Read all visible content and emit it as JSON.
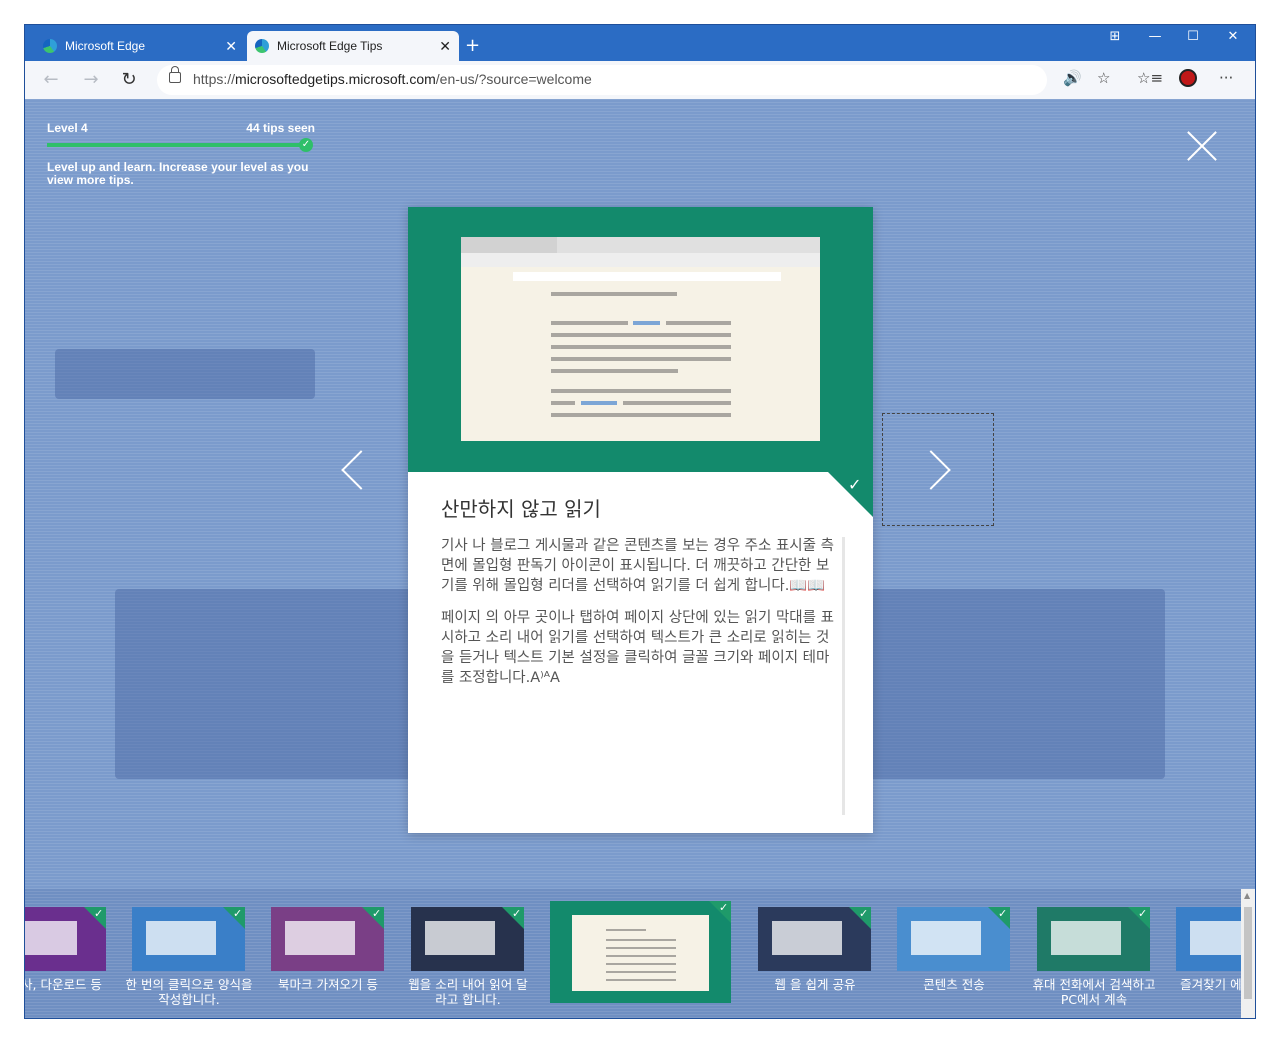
{
  "tabs": [
    {
      "label": "Microsoft Edge",
      "close": "✕"
    },
    {
      "label": "Microsoft Edge Tips",
      "close": "✕"
    }
  ],
  "new_tab": "+",
  "window_controls": {
    "minimize": "—",
    "maximize": "☐",
    "close": "✕",
    "extra": "⊞"
  },
  "nav": {
    "back": "←",
    "forward": "→",
    "refresh": "↻"
  },
  "address": {
    "scheme": "https://",
    "host": "microsoftedgetips.microsoft.com",
    "path": "/en-us/?source=welcome"
  },
  "toolbar_icons": {
    "read_aloud": "🔊",
    "favorite": "☆",
    "collections": "☆≡",
    "more": "···"
  },
  "level": {
    "label": "Level 4",
    "tips_seen": "44 tips seen",
    "progress": 1.0,
    "description": "Level up and learn. Increase your level as you view more tips."
  },
  "card": {
    "title": "산만하지 않고 읽기",
    "paragraphs": [
      "기사 나 블로그 게시물과 같은 콘텐츠를 보는 경우 주소 표시줄 측면에 몰입형 판독기 아이콘이 표시됩니다. 더 깨끗하고 간단한 보기를 위해 몰입형 리더를 선택하여 읽기를 더 쉽게 합니다.📖📖",
      "페이지 의 아무 곳이나 탭하여 페이지 상단에 있는 읽기 막대를 표시하고 소리 내어 읽기를 선택하여 텍스트가 큰 소리로 읽히는 것을 듣거나 텍스트 기본 설정을 클릭하여 글꼴 크기와 페이지 테마를 조정합니다.A⁾ᴬA"
    ]
  },
  "carousel": [
    {
      "label": "l, 역사, 다운로드 등",
      "color": "#6a2f8e",
      "seen": true
    },
    {
      "label": "한 번의 클릭으로 양식을 작성합니다.",
      "color": "#3a7fc8",
      "seen": true
    },
    {
      "label": "북마크 가져오기 등",
      "color": "#7a3f86",
      "seen": true
    },
    {
      "label": "웹을 소리 내어 읽어 달라고 합니다.",
      "color": "#27324d",
      "seen": true
    },
    {
      "label": "",
      "color": "#138a6c",
      "seen": true,
      "active": true
    },
    {
      "label": "웹 을 쉽게 공유",
      "color": "#2b3a5c",
      "seen": true
    },
    {
      "label": "콘텐츠 전송",
      "color": "#4a8ecf",
      "seen": true
    },
    {
      "label": "휴대 전화에서 검색하고 PC에서 계속",
      "color": "#1f7a67",
      "seen": true
    },
    {
      "label": "즐겨찾기 에 URL 편",
      "color": "#3a7fc8",
      "seen": false
    }
  ]
}
